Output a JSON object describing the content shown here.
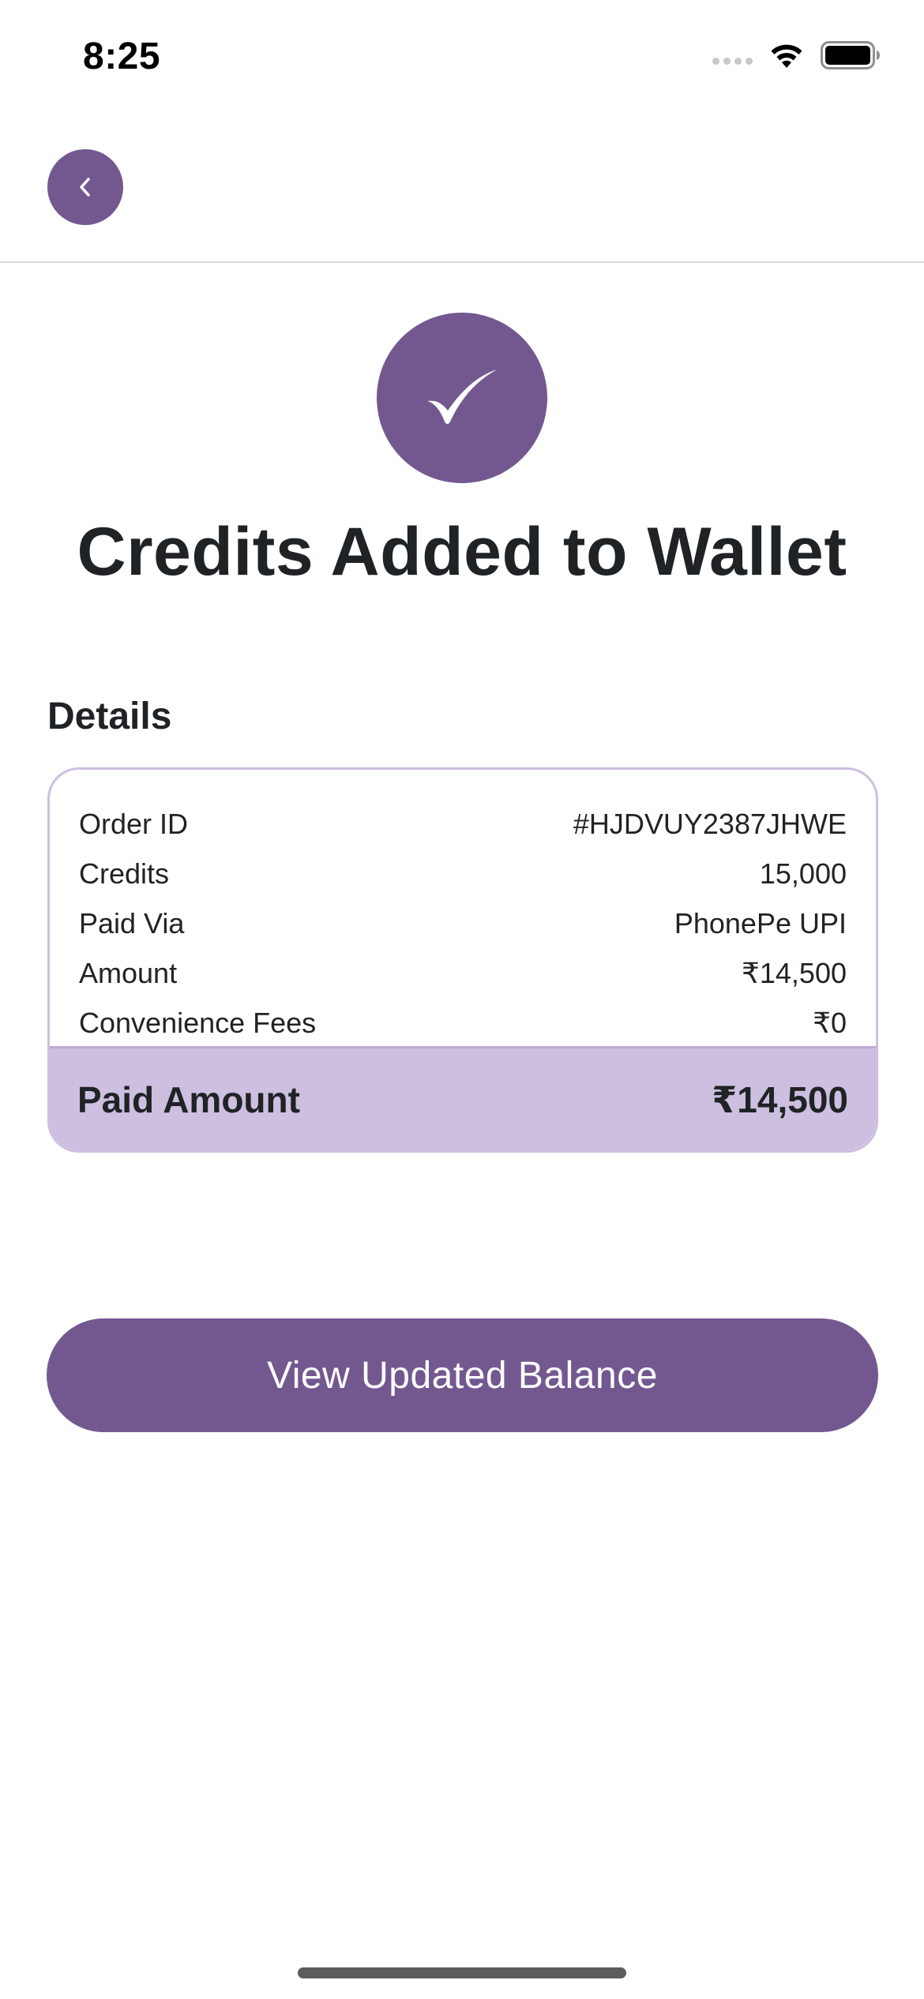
{
  "status_bar": {
    "time": "8:25"
  },
  "nav": {
    "back_icon": "chevron-left-icon"
  },
  "success": {
    "icon": "checkmark-icon",
    "title": "Credits Added to Wallet"
  },
  "details": {
    "heading": "Details",
    "rows": [
      {
        "label": "Order ID",
        "value": "#HJDVUY2387JHWE"
      },
      {
        "label": "Credits",
        "value": "15,000"
      },
      {
        "label": "Paid Via",
        "value": "PhonePe UPI"
      },
      {
        "label": "Amount",
        "value": "₹14,500"
      },
      {
        "label": "Convenience Fees",
        "value": "₹0"
      }
    ],
    "total_label": "Paid Amount",
    "total_value": "₹14,500"
  },
  "cta": {
    "label": "View Updated Balance"
  },
  "colors": {
    "accent": "#735890",
    "accent_light": "#cdbfdf",
    "card_border": "#cdbfe0",
    "text": "#1f2326"
  }
}
